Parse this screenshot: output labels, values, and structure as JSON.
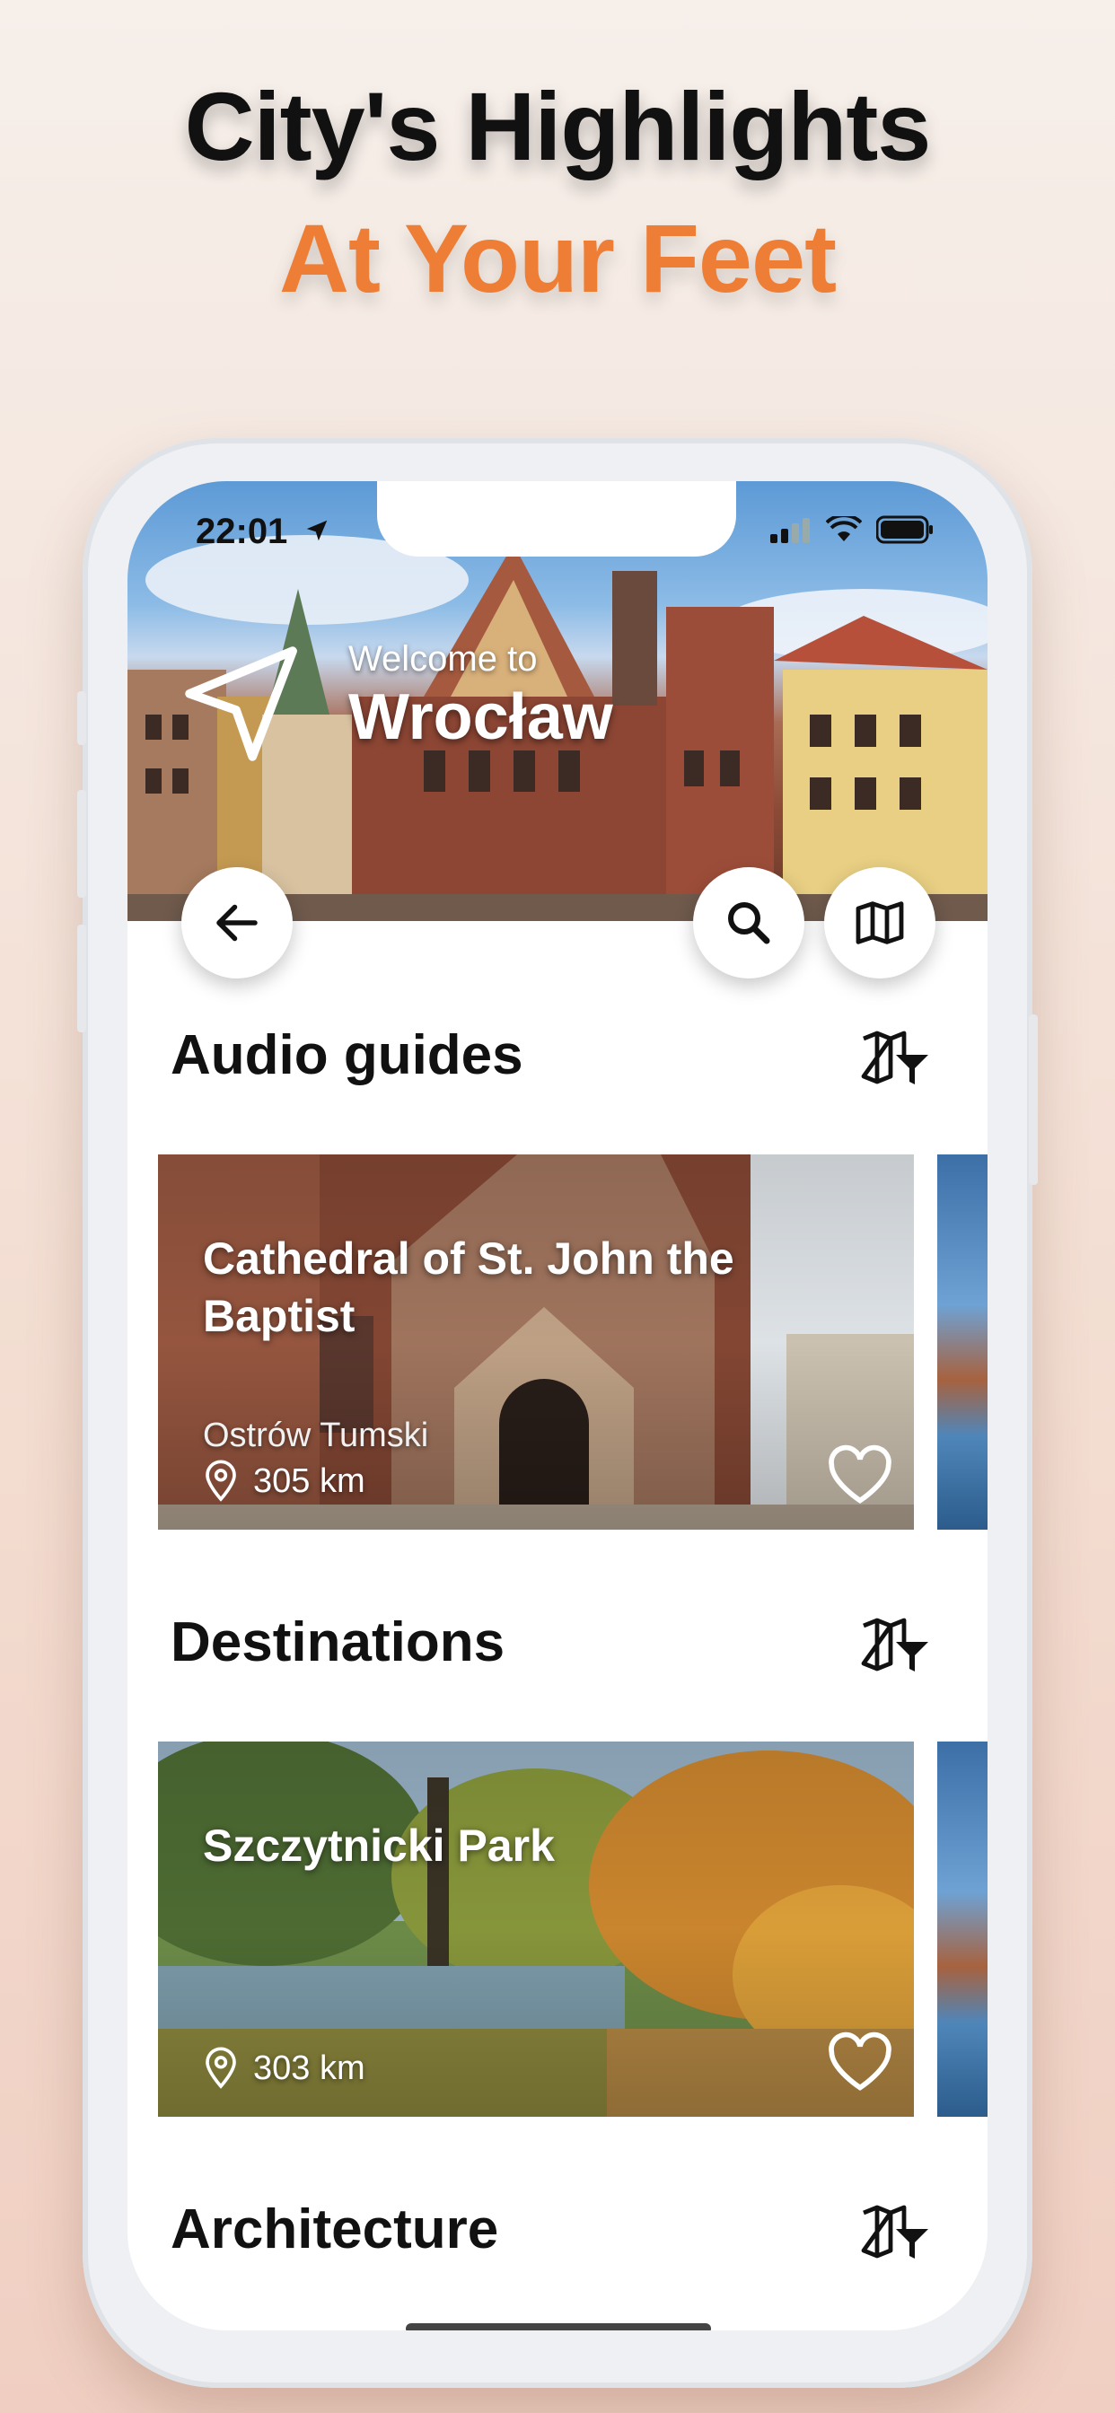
{
  "promo": {
    "line1": "City's Highlights",
    "line2": "At Your Feet"
  },
  "status_bar": {
    "time": "22:01"
  },
  "hero": {
    "welcome": "Welcome to",
    "city": "Wrocław"
  },
  "sections": [
    {
      "title": "Audio guides",
      "card": {
        "title": "Cathedral of St. John the Baptist",
        "subtitle": "Ostrów Tumski",
        "distance": "305 km"
      }
    },
    {
      "title": "Destinations",
      "card": {
        "title": "Szczytnicki Park",
        "distance": "303 km"
      }
    },
    {
      "title": "Architecture"
    }
  ],
  "icons": {
    "location_arrow": "location-arrow-icon",
    "back": "arrow-left-icon",
    "search": "search-icon",
    "map": "map-icon",
    "map_filter": "map-filter-icon",
    "pin": "location-pin-icon",
    "heart": "heart-icon"
  },
  "colors": {
    "accent": "#ee7e35",
    "title_text": "#111111"
  }
}
